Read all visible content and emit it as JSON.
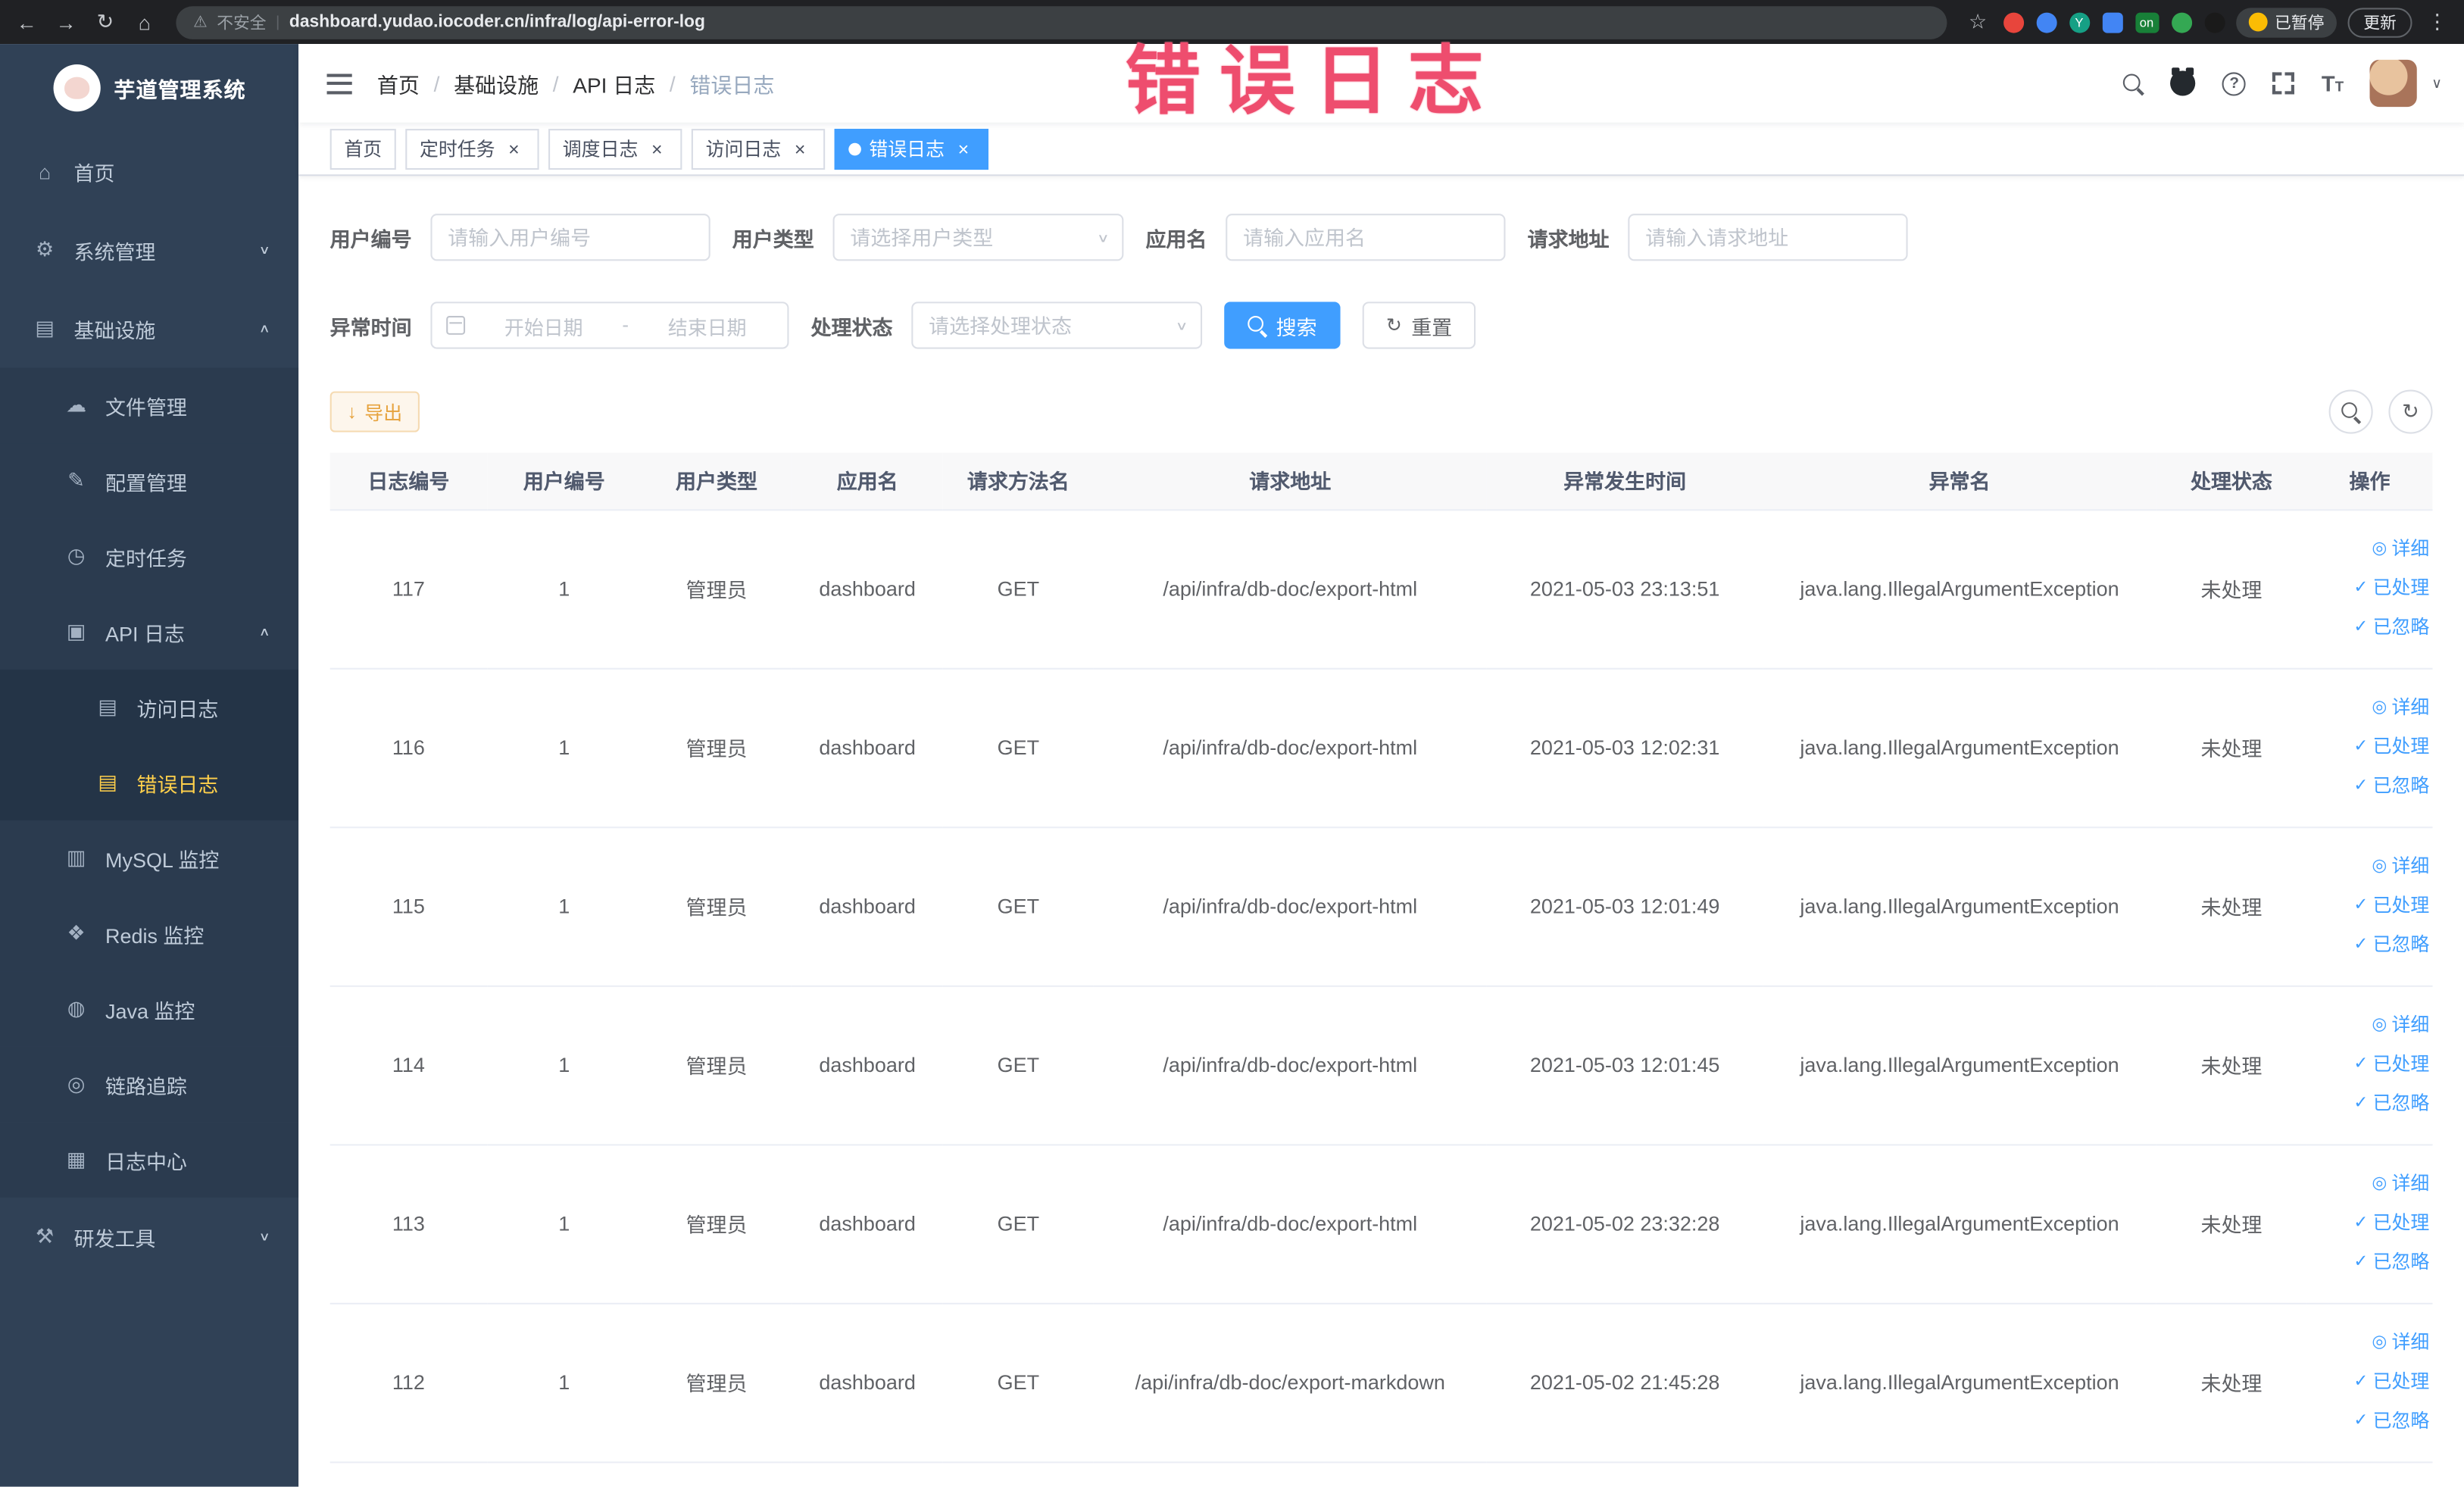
{
  "browser": {
    "security_label": "不安全",
    "url": "dashboard.yudao.iocoder.cn/infra/log/api-error-log",
    "paused_badge": "已暂停",
    "update_label": "更新",
    "extension_on_badge": "on"
  },
  "annotation": {
    "text": "错误日志",
    "color": "#ee4d6e"
  },
  "colors": {
    "accent": "#409eff",
    "sidebar_bg": "#304156",
    "active_menu_text": "#ffd04b",
    "warning_button": "#e6a23c"
  },
  "sidebar": {
    "logo_title": "芋道管理系统",
    "items": [
      {
        "label": "首页",
        "slug": "home",
        "level": 1,
        "icon": "home-icon",
        "glyph": "⌂"
      },
      {
        "label": "系统管理",
        "slug": "system-management",
        "level": 1,
        "icon": "gear-icon",
        "glyph": "⚙",
        "arrow": "down"
      },
      {
        "label": "基础设施",
        "slug": "infrastructure",
        "level": 1,
        "icon": "infrastructure-icon",
        "glyph": "▤",
        "arrow": "up"
      },
      {
        "label": "文件管理",
        "slug": "file-management",
        "level": 2,
        "icon": "cloud-file-icon",
        "glyph": "☁"
      },
      {
        "label": "配置管理",
        "slug": "config-management",
        "level": 2,
        "icon": "edit-config-icon",
        "glyph": "✎"
      },
      {
        "label": "定时任务",
        "slug": "scheduled-tasks",
        "level": 2,
        "icon": "timer-icon",
        "glyph": "◷"
      },
      {
        "label": "API 日志",
        "slug": "api-log",
        "level": 2,
        "icon": "api-log-icon",
        "glyph": "▣",
        "arrow": "up"
      },
      {
        "label": "访问日志",
        "slug": "access-log",
        "level": 3,
        "icon": "access-log-icon",
        "glyph": "▤"
      },
      {
        "label": "错误日志",
        "slug": "error-log",
        "level": 3,
        "icon": "error-log-icon",
        "glyph": "▤",
        "active": true
      },
      {
        "label": "MySQL 监控",
        "slug": "mysql-monitor",
        "level": 2,
        "icon": "database-icon",
        "glyph": "▥"
      },
      {
        "label": "Redis 监控",
        "slug": "redis-monitor",
        "level": 2,
        "icon": "redis-icon",
        "glyph": "❖"
      },
      {
        "label": "Java 监控",
        "slug": "java-monitor",
        "level": 2,
        "icon": "java-icon",
        "glyph": "◍"
      },
      {
        "label": "链路追踪",
        "slug": "trace",
        "level": 2,
        "icon": "trace-icon",
        "glyph": "◎"
      },
      {
        "label": "日志中心",
        "slug": "log-center",
        "level": 2,
        "icon": "log-center-icon",
        "glyph": "▦"
      },
      {
        "label": "研发工具",
        "slug": "dev-tools",
        "level": 1,
        "icon": "tools-icon",
        "glyph": "⚒",
        "arrow": "down"
      }
    ]
  },
  "navbar": {
    "breadcrumb": [
      "首页",
      "基础设施",
      "API 日志",
      "错误日志"
    ]
  },
  "tabs": [
    {
      "label": "首页",
      "slug": "home",
      "closable": false,
      "active": false
    },
    {
      "label": "定时任务",
      "slug": "scheduled-tasks",
      "closable": true,
      "active": false
    },
    {
      "label": "调度日志",
      "slug": "schedule-log",
      "closable": true,
      "active": false
    },
    {
      "label": "访问日志",
      "slug": "access-log",
      "closable": true,
      "active": false
    },
    {
      "label": "错误日志",
      "slug": "error-log",
      "closable": true,
      "active": true
    }
  ],
  "filters": {
    "user_id": {
      "label": "用户编号",
      "placeholder": "请输入用户编号"
    },
    "user_type": {
      "label": "用户类型",
      "placeholder": "请选择用户类型"
    },
    "app_name": {
      "label": "应用名",
      "placeholder": "请输入应用名"
    },
    "request_url": {
      "label": "请求地址",
      "placeholder": "请输入请求地址"
    },
    "exception_time": {
      "label": "异常时间",
      "start_placeholder": "开始日期",
      "separator": "-",
      "end_placeholder": "结束日期"
    },
    "process_status": {
      "label": "处理状态",
      "placeholder": "请选择处理状态"
    },
    "search_label": "搜索",
    "reset_label": "重置"
  },
  "toolbar": {
    "export_label": "导出"
  },
  "table": {
    "columns": [
      "日志编号",
      "用户编号",
      "用户类型",
      "应用名",
      "请求方法名",
      "请求地址",
      "异常发生时间",
      "异常名",
      "处理状态",
      "操作"
    ],
    "action_labels": [
      "详细",
      "已处理",
      "已忽略"
    ],
    "action_glyphs": [
      "◎",
      "✓",
      "✓"
    ],
    "action_slugs": [
      "detail",
      "processed",
      "ignored"
    ],
    "rows": [
      [
        "117",
        "1",
        "管理员",
        "dashboard",
        "GET",
        "/api/infra/db-doc/export-html",
        "2021-05-03 23:13:51",
        "java.lang.IllegalArgumentException",
        "未处理"
      ],
      [
        "116",
        "1",
        "管理员",
        "dashboard",
        "GET",
        "/api/infra/db-doc/export-html",
        "2021-05-03 12:02:31",
        "java.lang.IllegalArgumentException",
        "未处理"
      ],
      [
        "115",
        "1",
        "管理员",
        "dashboard",
        "GET",
        "/api/infra/db-doc/export-html",
        "2021-05-03 12:01:49",
        "java.lang.IllegalArgumentException",
        "未处理"
      ],
      [
        "114",
        "1",
        "管理员",
        "dashboard",
        "GET",
        "/api/infra/db-doc/export-html",
        "2021-05-03 12:01:45",
        "java.lang.IllegalArgumentException",
        "未处理"
      ],
      [
        "113",
        "1",
        "管理员",
        "dashboard",
        "GET",
        "/api/infra/db-doc/export-html",
        "2021-05-02 23:32:28",
        "java.lang.IllegalArgumentException",
        "未处理"
      ],
      [
        "112",
        "1",
        "管理员",
        "dashboard",
        "GET",
        "/api/infra/db-doc/export-markdown",
        "2021-05-02 21:45:28",
        "java.lang.IllegalArgumentException",
        "未处理"
      ]
    ]
  }
}
